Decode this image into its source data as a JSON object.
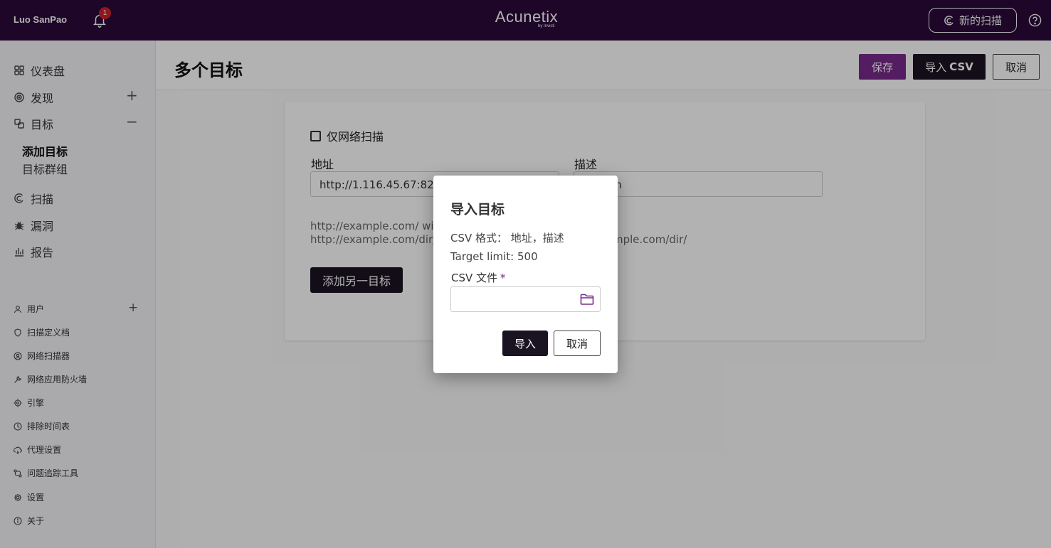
{
  "topbar": {
    "user_name": "Luo SanPao",
    "notification_count": "1",
    "logo_main": "Acunetix",
    "logo_sub": "by Invicti",
    "new_scan_label": "新的扫描"
  },
  "sidebar": {
    "items": [
      {
        "label": "仪表盘",
        "icon": "dashboard-icon"
      },
      {
        "label": "发现",
        "icon": "discovery-icon"
      },
      {
        "label": "目标",
        "icon": "targets-icon"
      },
      {
        "label": "扫描",
        "icon": "scans-icon"
      },
      {
        "label": "漏洞",
        "icon": "bug-icon"
      },
      {
        "label": "报告",
        "icon": "reports-icon"
      }
    ],
    "sub_items": [
      {
        "label": "添加目标",
        "active": true
      },
      {
        "label": "目标群组",
        "active": false
      }
    ],
    "settings_items": [
      {
        "label": "用户",
        "icon": "user-icon"
      },
      {
        "label": "扫描定义档",
        "icon": "shield-icon"
      },
      {
        "label": "网络扫描器",
        "icon": "network-scanner-icon"
      },
      {
        "label": "网络应用防火墙",
        "icon": "wrench-icon"
      },
      {
        "label": "引擎",
        "icon": "engine-icon"
      },
      {
        "label": "排除时间表",
        "icon": "clock-icon"
      },
      {
        "label": "代理设置",
        "icon": "proxy-icon"
      },
      {
        "label": "问题追踪工具",
        "icon": "issue-tracker-icon"
      },
      {
        "label": "设置",
        "icon": "gear-icon"
      },
      {
        "label": "关于",
        "icon": "info-icon"
      }
    ]
  },
  "header": {
    "title": "多个目标",
    "save_label": "保存",
    "import_label": "导入",
    "import_bold": "CSV",
    "cancel_label": "取消"
  },
  "form": {
    "network_only_label": "仅网络扫描",
    "address_label": "地址",
    "address_value": "http://1.116.45.67:82/",
    "description_label": "描述",
    "description_value": "an",
    "help_line1": "http://example.com/ wil",
    "help_line2": "http://example.com/dir/",
    "help_line2_right": "mple.com/dir/",
    "add_target_label": "添加另一目标"
  },
  "modal": {
    "title": "导入目标",
    "csv_format": "CSV 格式： 地址，描述",
    "target_limit": "Target limit: 500",
    "file_label": "CSV 文件",
    "required_mark": "*",
    "import_button": "导入",
    "cancel_button": "取消"
  },
  "colors": {
    "topbar": "#2a0a3a",
    "accent": "#7a2a8c",
    "dark_button": "#1a1422",
    "badge": "#d0202a"
  }
}
